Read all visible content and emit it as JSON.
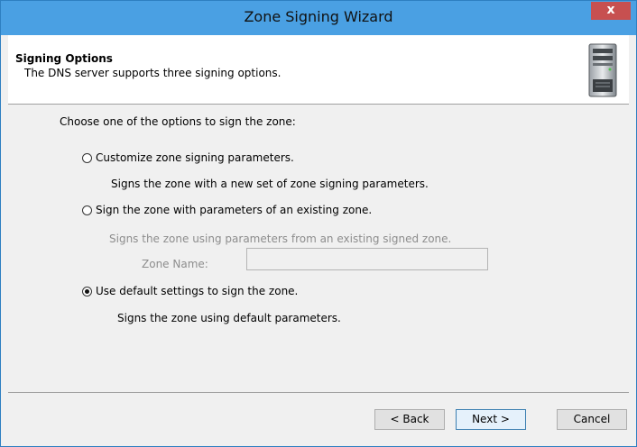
{
  "window": {
    "title": "Zone Signing Wizard",
    "close_label": "x"
  },
  "header": {
    "title": "Signing Options",
    "subtitle": "The DNS server supports three signing options.",
    "icon": "server-icon"
  },
  "prompt": "Choose one of the options to sign the zone:",
  "options": [
    {
      "label": "Customize zone signing parameters.",
      "description": "Signs the zone with a new set of zone signing parameters.",
      "checked": false
    },
    {
      "label": "Sign the zone with parameters of an existing zone.",
      "description": "Signs the zone using parameters from an existing signed zone.",
      "checked": false
    },
    {
      "label": "Use default settings to sign the zone.",
      "description": "Signs the zone using default parameters.",
      "checked": true
    }
  ],
  "zone_name": {
    "label": "Zone Name:",
    "value": ""
  },
  "buttons": {
    "back": "< Back",
    "next": "Next >",
    "cancel": "Cancel"
  },
  "colors": {
    "titlebar": "#4aa0e3",
    "close": "#c75050",
    "border": "#2d7fc1"
  }
}
